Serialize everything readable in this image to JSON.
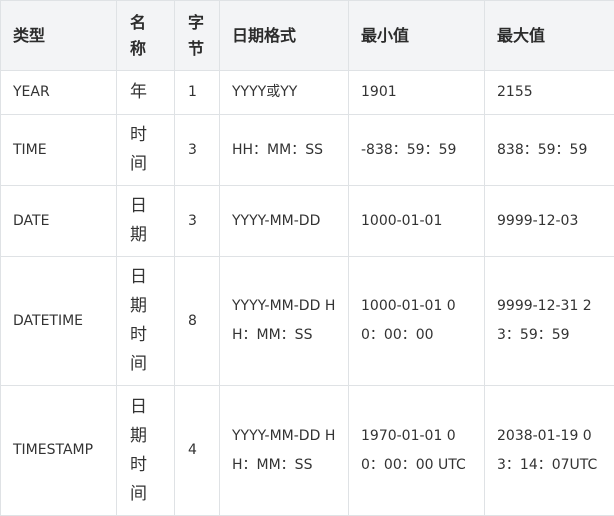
{
  "table": {
    "headers": [
      "类型",
      "名称",
      "字节",
      "日期格式",
      "最小值",
      "最大值"
    ],
    "rows": [
      {
        "type": "YEAR",
        "name": "年",
        "bytes": "1",
        "format": "YYYY或YY",
        "min": "1901",
        "max": "2155"
      },
      {
        "type": "TIME",
        "name": "时间",
        "bytes": "3",
        "format": "HH：MM：SS",
        "min": "-838：59：59",
        "max": "838：59：59"
      },
      {
        "type": "DATE",
        "name": "日期",
        "bytes": "3",
        "format": "YYYY-MM-DD",
        "min": "1000-01-01",
        "max": "9999-12-03"
      },
      {
        "type": "DATETIME",
        "name": "日期时间",
        "bytes": "8",
        "format": "YYYY-MM-DD HH：MM：SS",
        "min": "1000-01-01 00：00：00",
        "max": "9999-12-31 23：59：59"
      },
      {
        "type": "TIMESTAMP",
        "name": "日期时间",
        "bytes": "4",
        "format": "YYYY-MM-DD HH：MM：SS",
        "min": "1970-01-01 00：00：00 UTC",
        "max": "2038-01-19 03：14：07UTC"
      }
    ]
  }
}
